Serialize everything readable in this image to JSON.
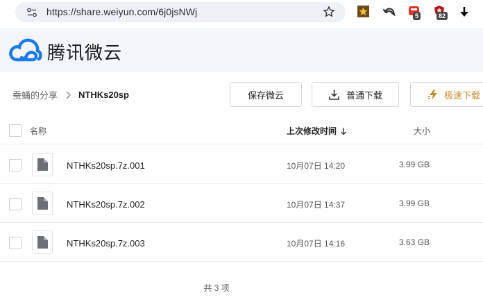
{
  "browser": {
    "url": "https://share.weiyun.com/6j0jsNWj",
    "extensions": [
      {
        "icon": "star-extension-icon"
      },
      {
        "icon": "back-arrow-extension-icon"
      },
      {
        "icon": "red-extension-icon",
        "badge": "5"
      },
      {
        "icon": "shield-extension-icon",
        "badge": "82"
      },
      {
        "icon": "download-arrow-icon"
      }
    ]
  },
  "header": {
    "logo_text": "腾讯微云"
  },
  "breadcrumb": {
    "parent": "蚕蛹的分享",
    "current": "NTHKs20sp"
  },
  "toolbar": {
    "save_label": "保存微云",
    "download_label": "普通下载",
    "fast_label": "极速下载"
  },
  "table": {
    "columns": {
      "name": "名称",
      "time": "上次修改时间",
      "size": "大小"
    },
    "rows": [
      {
        "name": "NTHKs20sp.7z.001",
        "time": "10月07日 14:20",
        "size": "3.99 GB"
      },
      {
        "name": "NTHKs20sp.7z.002",
        "time": "10月07日 14:37",
        "size": "3.99 GB"
      },
      {
        "name": "NTHKs20sp.7z.003",
        "time": "10月07日 14:16",
        "size": "3.63 GB"
      }
    ]
  },
  "footer": {
    "count": "共 3 项"
  },
  "colors": {
    "brand_blue": "#1e7ae8",
    "fast_gold": "#c38b2c",
    "header_bg": "#f2f5fa"
  }
}
